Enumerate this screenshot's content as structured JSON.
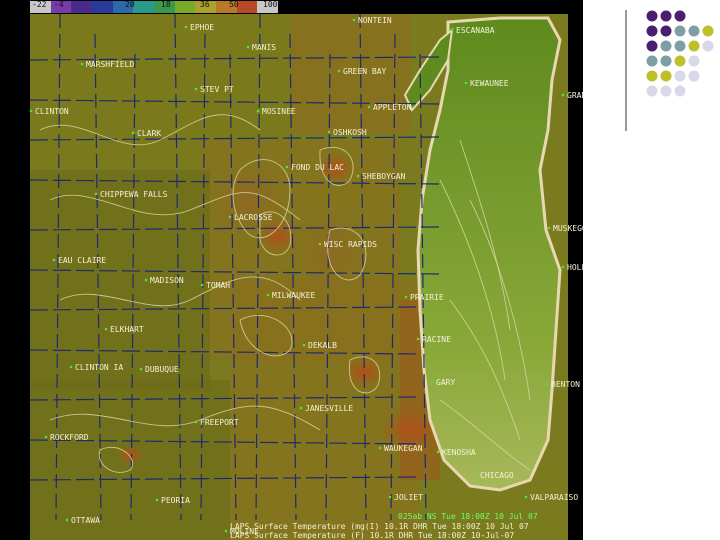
{
  "colorbar": {
    "colors": [
      "#c8c8c8",
      "#7a3aa8",
      "#4a2a8a",
      "#2a3a9a",
      "#2a6aaa",
      "#2a9a8a",
      "#3a9a4a",
      "#7aaa2a",
      "#aaa22a",
      "#b87a2a",
      "#b84a2a",
      "#c8c8c8"
    ],
    "ticks": [
      "-22",
      "-4",
      "20",
      "18",
      "36",
      "50",
      "100"
    ]
  },
  "map": {
    "land_colors": [
      "#7a7a1e",
      "#8a701e",
      "#6a6a1a",
      "#906a20",
      "#a0581c"
    ],
    "lake_color": "#5e8a1e",
    "shore_color": "#e8d8b0",
    "border_color": "#1e2a6e",
    "contour_color": "#d8d6a0",
    "lake_name": "",
    "cities": [
      "NONTEIN",
      "EPHOE",
      "ESCANABA",
      "MANIS",
      "MARSHFIELD",
      "STEV PT",
      "CLINTON",
      "CLARK",
      "MOSINEE",
      "GREEN BAY",
      "KEWAUNEE",
      "OSHKOSH",
      "APPLETON",
      "SHEBOYGAN",
      "CHIPPEWA FALLS",
      "EAU CLAIRE",
      "FOND DU LAC",
      "LACROSSE",
      "WISC RAPIDS",
      "MADISON",
      "MILWAUKEE",
      "PRAIRIE",
      "TOMAH",
      "RACINE",
      "KENOSHA",
      "ROCKFORD",
      "JANESVILLE",
      "CHICAGO",
      "DUBUQUE",
      "WAUKEGAN",
      "MUSKEGON",
      "GRAND HAVEN",
      "HOLLAND",
      "BENTON HBR",
      "JOLIET",
      "OTTAWA",
      "PEORIA",
      "MOLINE",
      "CLINTON IA",
      "FREEPORT",
      "DEKALB",
      "GARY",
      "VALPARAISO",
      "ELKHART"
    ]
  },
  "status": {
    "line1": "025ab NS   Tue 18:00Z 10 Jul 07",
    "line2": "LAPS Surface Temperature (mg(I) 10.1R  DHR Tue 18:00Z 10 Jul 07",
    "line3": "LAPS Surface Temperature (F) 10.1R  DHR Tue 18:00Z 10-Jul-07"
  },
  "legend": {
    "dot_colors": [
      "#4b1f6f",
      "#7f9ea5",
      "#bfbf2a",
      "#d8d8e8"
    ]
  }
}
